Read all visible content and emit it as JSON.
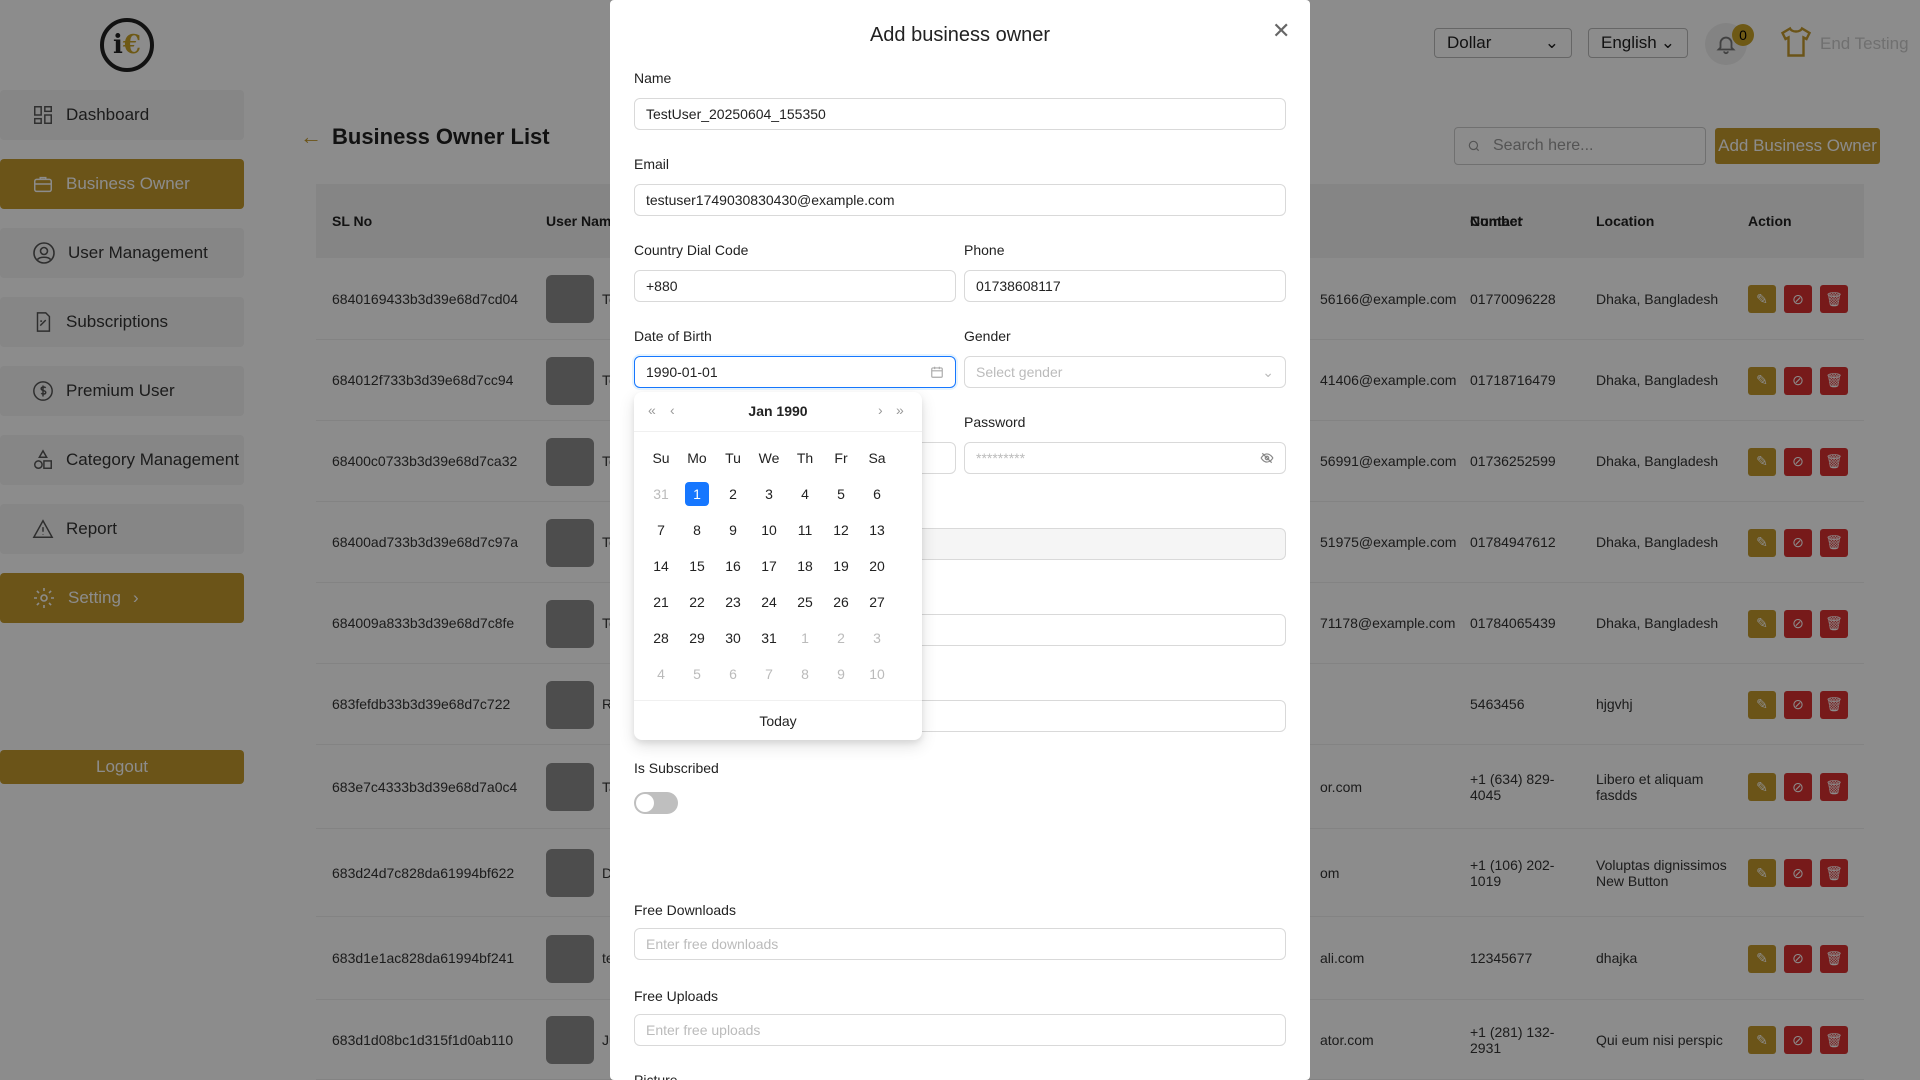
{
  "header": {
    "currency": "Dollar",
    "language": "English",
    "notification_count": "0",
    "user_name": "End Testing"
  },
  "sidebar": {
    "items": [
      {
        "label": "Dashboard",
        "icon": "dashboard-icon"
      },
      {
        "label": "Business Owner",
        "icon": "briefcase-icon",
        "active": true
      },
      {
        "label": "User Management",
        "icon": "user-icon"
      },
      {
        "label": "Subscriptions",
        "icon": "document-icon"
      },
      {
        "label": "Premium User",
        "icon": "dollar-icon"
      },
      {
        "label": "Category Management",
        "icon": "shapes-icon"
      },
      {
        "label": "Report",
        "icon": "warning-icon"
      },
      {
        "label": "Setting",
        "icon": "gear-icon",
        "active": true
      }
    ],
    "logout": "Logout"
  },
  "page": {
    "title": "Business Owner List",
    "search_placeholder": "Search here...",
    "add_button": "Add Business Owner"
  },
  "table": {
    "headers": {
      "sl": "SL No",
      "user": "User Nam",
      "contact1": "Contact",
      "contact2": "Number",
      "location": "Location",
      "action": "Action"
    },
    "rows": [
      {
        "id": "6840169433b3d39e68d7cd04",
        "name": "Te",
        "email": "56166@example.com",
        "phone": "01770096228",
        "location": "Dhaka, Bangladesh"
      },
      {
        "id": "684012f733b3d39e68d7cc94",
        "name": "Te",
        "email": "41406@example.com",
        "phone": "01718716479",
        "location": "Dhaka, Bangladesh"
      },
      {
        "id": "68400c0733b3d39e68d7ca32",
        "name": "Te",
        "email": "56991@example.com",
        "phone": "01736252599",
        "location": "Dhaka, Bangladesh"
      },
      {
        "id": "68400ad733b3d39e68d7c97a",
        "name": "Te",
        "email": "51975@example.com",
        "phone": "01784947612",
        "location": "Dhaka, Bangladesh"
      },
      {
        "id": "684009a833b3d39e68d7c8fe",
        "name": "Te",
        "email": "71178@example.com",
        "phone": "01784065439",
        "location": "Dhaka, Bangladesh"
      },
      {
        "id": "683fefdb33b3d39e68d7c722",
        "name": "R",
        "email": "",
        "phone": "5463456",
        "location": "hjgvhj"
      },
      {
        "id": "683e7c4333b3d39e68d7a0c4",
        "name": "Ta",
        "email": "or.com",
        "phone": "+1 (634) 829-4045",
        "location": "Libero et aliquam fasdds"
      },
      {
        "id": "683d24d7c828da61994bf622",
        "name": "D",
        "email": "om",
        "phone": "+1 (106) 202-1019",
        "location": "Voluptas dignissimos New Button"
      },
      {
        "id": "683d1e1ac828da61994bf241",
        "name": "te",
        "email": "ali.com",
        "phone": "12345677",
        "location": "dhajka"
      },
      {
        "id": "683d1d08bc1d315f1d0ab110",
        "name": "Ju",
        "email": "ator.com",
        "phone": "+1 (281) 132-2931",
        "location": "Qui eum nisi perspic"
      }
    ]
  },
  "modal": {
    "title": "Add business owner",
    "name_label": "Name",
    "name_value": "TestUser_20250604_155350",
    "email_label": "Email",
    "email_value": "testuser1749030830430@example.com",
    "dial_label": "Country Dial Code",
    "dial_value": "+880",
    "phone_label": "Phone",
    "phone_value": "01738608117",
    "dob_label": "Date of Birth",
    "dob_value": "1990-01-01",
    "gender_label": "Gender",
    "gender_placeholder": "Select gender",
    "password_label": "Password",
    "password_value": "*********",
    "subscribed_label": "Is Subscribed",
    "downloads_label": "Free Downloads",
    "downloads_placeholder": "Enter free downloads",
    "uploads_label": "Free Uploads",
    "uploads_placeholder": "Enter free uploads",
    "picture_label": "Picture"
  },
  "datepicker": {
    "month": "Jan",
    "year": "1990",
    "weekdays": [
      "Su",
      "Mo",
      "Tu",
      "We",
      "Th",
      "Fr",
      "Sa"
    ],
    "days": [
      [
        "31",
        "1",
        "2",
        "3",
        "4",
        "5",
        "6"
      ],
      [
        "7",
        "8",
        "9",
        "10",
        "11",
        "12",
        "13"
      ],
      [
        "14",
        "15",
        "16",
        "17",
        "18",
        "19",
        "20"
      ],
      [
        "21",
        "22",
        "23",
        "24",
        "25",
        "26",
        "27"
      ],
      [
        "28",
        "29",
        "30",
        "31",
        "1",
        "2",
        "3"
      ],
      [
        "4",
        "5",
        "6",
        "7",
        "8",
        "9",
        "10"
      ]
    ],
    "today": "Today"
  }
}
